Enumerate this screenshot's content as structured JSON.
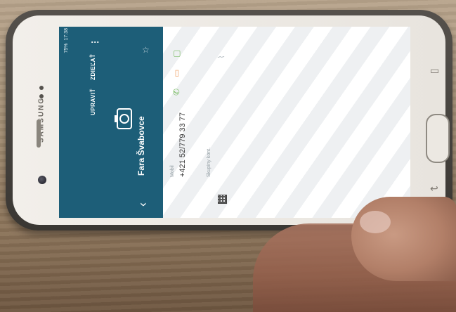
{
  "device": {
    "brand": "SAMSUNG"
  },
  "status_bar": {
    "time": "17:38",
    "battery": "75%"
  },
  "contact_header": {
    "name": "Fara Švabovce",
    "link_label": "UPRAVIŤ",
    "delete_label": "ZDIEĽAŤ",
    "more_icon": "kebab-menu-icon",
    "back_icon": "chevron-back-icon",
    "photo_icon": "camera-icon",
    "favorite_icon": "star-icon"
  },
  "details": {
    "phone_label": "Mobil",
    "phone_number": "+421 52/779 33 77",
    "group_label": "Skupiny kont.",
    "call_icon": "phone-icon",
    "message_icon": "message-icon",
    "video_icon": "video-icon",
    "attach_icon": "paperclip-icon"
  },
  "colors": {
    "header": "#1d5e78",
    "accent_green": "#7fbf6a",
    "accent_orange": "#f0a064"
  }
}
